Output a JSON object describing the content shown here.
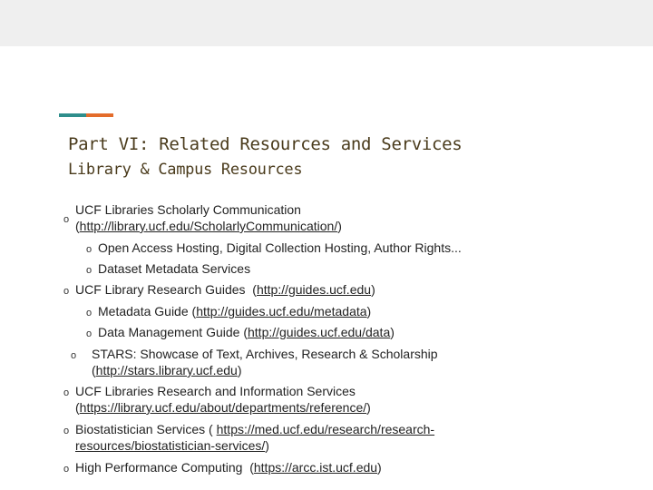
{
  "slide": {
    "title": "Part VI: Related Resources and Services",
    "subtitle": "Library & Campus Resources"
  },
  "items": [
    {
      "label": "UCF Libraries Scholarly Communication",
      "url": "http://library.ucf.edu/ScholarlyCommunication/"
    },
    {
      "label": "Open Access Hosting, Digital Collection Hosting, Author Rights..."
    },
    {
      "label": "Dataset Metadata Services"
    },
    {
      "label": "UCF Library Research Guides",
      "url": "http://guides.ucf.edu"
    },
    {
      "label": "Metadata Guide",
      "url": "http://guides.ucf.edu/metadata"
    },
    {
      "label": "Data Management Guide",
      "url": "http://guides.ucf.edu/data"
    },
    {
      "label": "STARS: Showcase of Text, Archives, Research & Scholarship",
      "url": "http://stars.library.ucf.edu"
    },
    {
      "label": "UCF Libraries Research and Information Services",
      "url": "https://library.ucf.edu/about/departments/reference/"
    },
    {
      "label": "Biostatistician Services",
      "url_part1": "https://med.ucf.edu/research/research-",
      "url_part2": "resources/biostatistician-services/"
    },
    {
      "label": "High Performance Computing",
      "url": "https://arcc.ist.ucf.edu"
    }
  ],
  "bullet_glyph": "o"
}
